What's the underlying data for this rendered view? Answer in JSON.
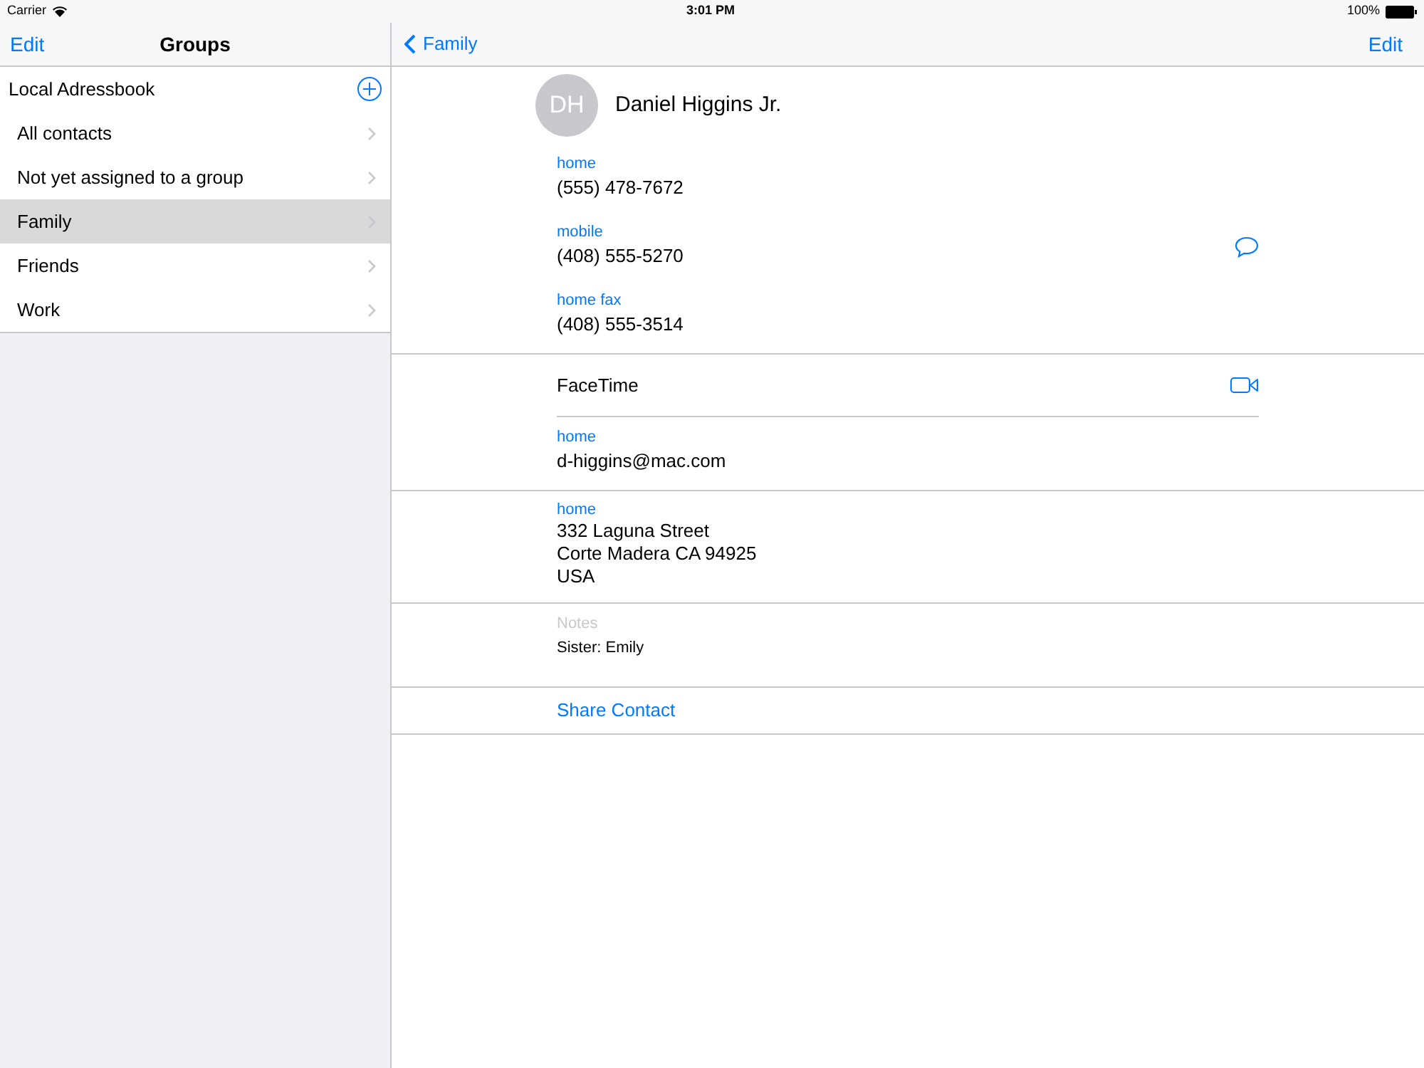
{
  "status_bar": {
    "carrier": "Carrier",
    "time": "3:01 PM",
    "battery": "100%"
  },
  "sidebar": {
    "edit": "Edit",
    "title": "Groups",
    "section": "Local Adressbook",
    "groups": [
      {
        "label": "All contacts",
        "selected": false
      },
      {
        "label": "Not yet assigned to a group",
        "selected": false
      },
      {
        "label": "Family",
        "selected": true
      },
      {
        "label": "Friends",
        "selected": false
      },
      {
        "label": "Work",
        "selected": false
      }
    ]
  },
  "detail": {
    "back": "Family",
    "edit": "Edit",
    "avatar": "DH",
    "name": "Daniel Higgins Jr.",
    "phones": [
      {
        "label": "home",
        "value": "(555) 478-7672"
      },
      {
        "label": "mobile",
        "value": "(408) 555-5270",
        "message": true
      },
      {
        "label": "home fax",
        "value": "(408) 555-3514"
      }
    ],
    "facetime": "FaceTime",
    "emails": [
      {
        "label": "home",
        "value": "d-higgins@mac.com"
      }
    ],
    "address": {
      "label": "home",
      "lines": [
        "332 Laguna Street",
        "Corte Madera CA 94925",
        "USA"
      ]
    },
    "notes": {
      "label": "Notes",
      "value": "Sister: Emily"
    },
    "share": "Share Contact"
  }
}
